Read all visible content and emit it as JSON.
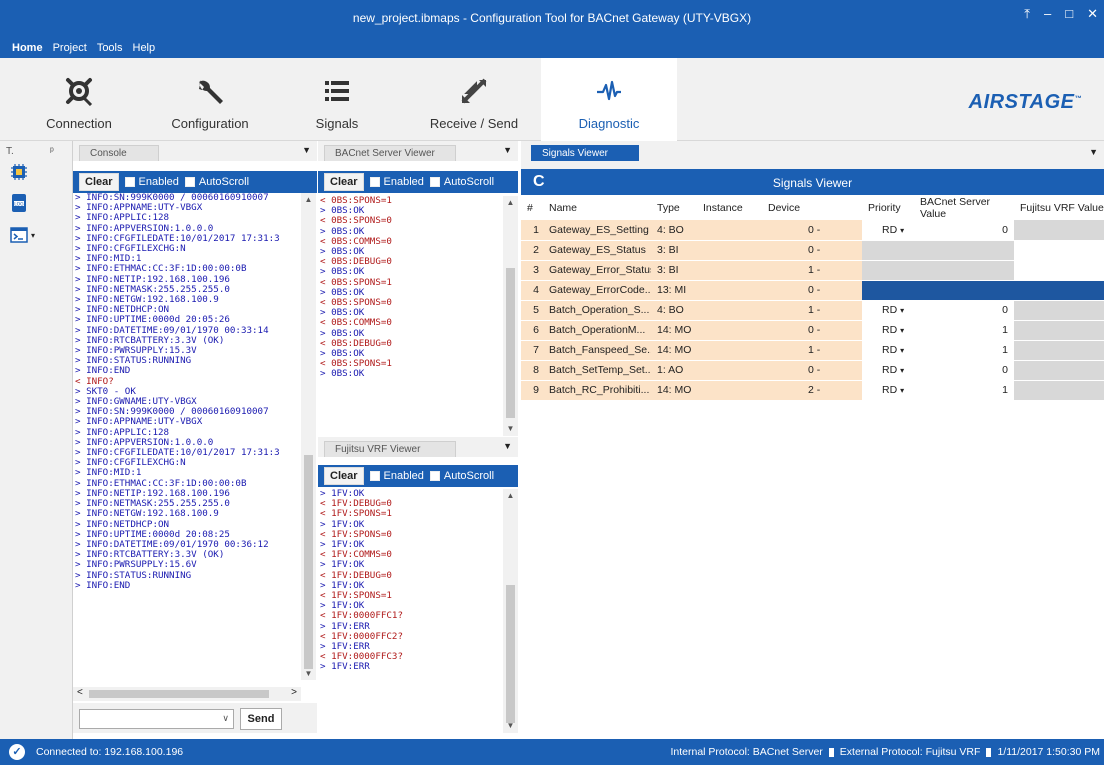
{
  "window": {
    "title": "new_project.ibmaps - Configuration Tool for BACnet Gateway (UTY-VBGX)",
    "controls": [
      "⤒",
      "–",
      "□",
      "✕"
    ]
  },
  "menu": {
    "items": [
      "Home",
      "Project",
      "Tools",
      "Help"
    ]
  },
  "ribbon": {
    "buttons": [
      {
        "label": "Connection",
        "icon": "connection-icon"
      },
      {
        "label": "Configuration",
        "icon": "wrench-icon"
      },
      {
        "label": "Signals",
        "icon": "list-icon"
      },
      {
        "label": "Receive / Send",
        "icon": "transfer-icon"
      },
      {
        "label": "Diagnostic",
        "icon": "waveform-icon"
      }
    ],
    "logo": "AIRSTAGE",
    "logo_tm": "™",
    "accent": "#1b5fb3"
  },
  "toolstrip": {
    "header": "T.",
    "pin": "ᵖ",
    "icons": [
      "chip-icon",
      "log-icon",
      "terminal-icon"
    ]
  },
  "console": {
    "tab": "Console",
    "clear": "Clear",
    "enabled": "Enabled",
    "autoscroll": "AutoScroll",
    "lines": [
      "> INFO:SN:999K0000 / 00060160910007",
      "> INFO:APPNAME:UTY-VBGX",
      "> INFO:APPLIC:128",
      "> INFO:APPVERSION:1.0.0.0",
      "> INFO:CFGFILEDATE:10/01/2017 17:31:3",
      "> INFO:CFGFILEXCHG:N",
      "> INFO:MID:1",
      "> INFO:ETHMAC:CC:3F:1D:00:00:0B",
      "> INFO:NETIP:192.168.100.196",
      "> INFO:NETMASK:255.255.255.0",
      "> INFO:NETGW:192.168.100.9",
      "> INFO:NETDHCP:ON",
      "> INFO:UPTIME:0000d 20:05:26",
      "> INFO:DATETIME:09/01/1970 00:33:14",
      "> INFO:RTCBATTERY:3.3V (OK)",
      "> INFO:PWRSUPPLY:15.3V",
      "> INFO:STATUS:RUNNING",
      "> INFO:END",
      "< INFO?",
      "> SKT0 - OK",
      "> INFO:GWNAME:UTY-VBGX",
      "> INFO:SN:999K0000 / 00060160910007",
      "> INFO:APPNAME:UTY-VBGX",
      "> INFO:APPLIC:128",
      "> INFO:APPVERSION:1.0.0.0",
      "> INFO:CFGFILEDATE:10/01/2017 17:31:3",
      "> INFO:CFGFILEXCHG:N",
      "> INFO:MID:1",
      "> INFO:ETHMAC:CC:3F:1D:00:00:0B",
      "> INFO:NETIP:192.168.100.196",
      "> INFO:NETMASK:255.255.255.0",
      "> INFO:NETGW:192.168.100.9",
      "> INFO:NETDHCP:ON",
      "> INFO:UPTIME:0000d 20:08:25",
      "> INFO:DATETIME:09/01/1970 00:36:12",
      "> INFO:RTCBATTERY:3.3V (OK)",
      "> INFO:PWRSUPPLY:15.6V",
      "> INFO:STATUS:RUNNING",
      "> INFO:END"
    ],
    "send": "Send"
  },
  "bacnet_viewer": {
    "tab": "BACnet Server Viewer",
    "clear": "Clear",
    "enabled": "Enabled",
    "autoscroll": "AutoScroll",
    "lines": [
      "< 0BS:SPONS=1",
      "> 0BS:OK",
      "< 0BS:SPONS=0",
      "> 0BS:OK",
      "< 0BS:COMMS=0",
      "> 0BS:OK",
      "< 0BS:DEBUG=0",
      "> 0BS:OK",
      "< 0BS:SPONS=1",
      "> 0BS:OK",
      "< 0BS:SPONS=0",
      "> 0BS:OK",
      "< 0BS:COMMS=0",
      "> 0BS:OK",
      "< 0BS:DEBUG=0",
      "> 0BS:OK",
      "< 0BS:SPONS=1",
      "> 0BS:OK"
    ]
  },
  "fujitsu_viewer": {
    "tab": "Fujitsu VRF Viewer",
    "clear": "Clear",
    "enabled": "Enabled",
    "autoscroll": "AutoScroll",
    "lines": [
      "> 1FV:OK",
      "< 1FV:DEBUG=0",
      "< 1FV:SPONS=1",
      "> 1FV:OK",
      "< 1FV:SPONS=0",
      "> 1FV:OK",
      "< 1FV:COMMS=0",
      "> 1FV:OK",
      "< 1FV:DEBUG=0",
      "> 1FV:OK",
      "< 1FV:SPONS=1",
      "> 1FV:OK",
      "< 1FV:0000FFC1?",
      "> 1FV:ERR",
      "< 1FV:0000FFC2?",
      "> 1FV:ERR",
      "< 1FV:0000FFC3?",
      "> 1FV:ERR"
    ]
  },
  "signals_viewer": {
    "tab": "Signals Viewer",
    "title": "Signals Viewer",
    "columns": [
      "#",
      "Name",
      "Type",
      "Instance",
      "Device",
      "Priority",
      "BACnet Server Value",
      "Fujitsu VRF Value"
    ],
    "rows": [
      {
        "num": "1",
        "name": "Gateway_ES_Setting",
        "type": "4: BO",
        "device_num": "0",
        "device_sep": "-",
        "priority": "RD",
        "bacnet_value": "0",
        "style": "prio"
      },
      {
        "num": "2",
        "name": "Gateway_ES_Status",
        "type": "3: BI",
        "device_num": "0",
        "device_sep": "-",
        "priority": "",
        "bacnet_value": "",
        "style": "grey"
      },
      {
        "num": "3",
        "name": "Gateway_Error_Status",
        "type": "3: BI",
        "device_num": "1",
        "device_sep": "-",
        "priority": "",
        "bacnet_value": "",
        "style": "grey"
      },
      {
        "num": "4",
        "name": "Gateway_ErrorCode...",
        "type": "13: MI",
        "device_num": "0",
        "device_sep": "-",
        "priority": "",
        "bacnet_value": "",
        "style": "dark"
      },
      {
        "num": "5",
        "name": "Batch_Operation_S...",
        "type": "4: BO",
        "device_num": "1",
        "device_sep": "-",
        "priority": "RD",
        "bacnet_value": "0",
        "style": "prio"
      },
      {
        "num": "6",
        "name": "Batch_OperationM...",
        "type": "14: MO",
        "device_num": "0",
        "device_sep": "-",
        "priority": "RD",
        "bacnet_value": "1",
        "style": "prio"
      },
      {
        "num": "7",
        "name": "Batch_Fanspeed_Se...",
        "type": "14: MO",
        "device_num": "1",
        "device_sep": "-",
        "priority": "RD",
        "bacnet_value": "1",
        "style": "prio"
      },
      {
        "num": "8",
        "name": "Batch_SetTemp_Set...",
        "type": "1: AO",
        "device_num": "0",
        "device_sep": "-",
        "priority": "RD",
        "bacnet_value": "0",
        "style": "prio"
      },
      {
        "num": "9",
        "name": "Batch_RC_Prohibiti...",
        "type": "14: MO",
        "device_num": "2",
        "device_sep": "-",
        "priority": "RD",
        "bacnet_value": "1",
        "style": "prio"
      }
    ]
  },
  "status": {
    "connected": "Connected to: 192.168.100.196",
    "internal": "Internal Protocol: BACnet Server",
    "external": "External Protocol: Fujitsu VRF",
    "datetime": "1/11/2017 1:50:30 PM"
  }
}
